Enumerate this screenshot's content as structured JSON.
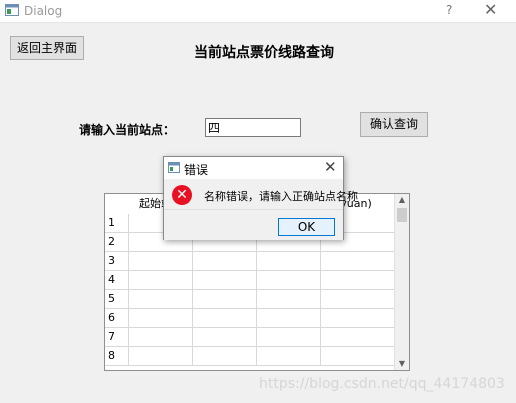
{
  "window": {
    "title": "Dialog",
    "help_glyph": "?",
    "close_glyph": "✕"
  },
  "toolbar": {
    "back_label": "返回主界面",
    "query_label": "确认查询"
  },
  "page_title": "当前站点票价线路查询",
  "station": {
    "label": "请输入当前站点：",
    "value": "四"
  },
  "table": {
    "headers": [
      "起始站",
      "",
      "",
      "价(yuan)"
    ],
    "row_numbers": [
      "1",
      "2",
      "3",
      "4",
      "5",
      "6",
      "7",
      "8"
    ]
  },
  "dialog": {
    "title": "错误",
    "message": "名称错误，请输入正确站点名称",
    "ok_label": "OK",
    "close_glyph": "✕",
    "error_glyph": "✕",
    "error_color": "#e81123"
  },
  "watermark": "https://blog.csdn.net/qq_44174803"
}
